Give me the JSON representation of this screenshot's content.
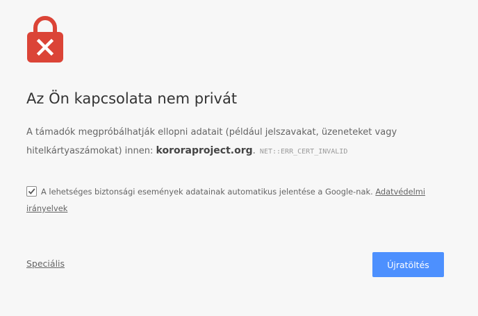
{
  "icon": {
    "name": "lock-error-icon",
    "color": "#db4437"
  },
  "title": "Az Ön kapcsolata nem privát",
  "explanation": {
    "before": "A támadók megpróbálhatják ellopni adatait (például jelszavakat, üzeneteket vagy hitelkártyaszámokat) innen: ",
    "hostname": "kororaproject.org",
    "after": ".",
    "error_code": "NET::ERR_CERT_INVALID"
  },
  "reporting": {
    "checked": true,
    "label": "A lehetséges biztonsági események adatainak automatikus jelentése a Google-nak.",
    "link": "Adatvédelmi irányelvek"
  },
  "advanced_link": "Speciális",
  "reload_button": "Újratöltés",
  "colors": {
    "background": "#f7f7f7",
    "button": "#4d90fe",
    "title": "#333333",
    "text": "#646464"
  }
}
